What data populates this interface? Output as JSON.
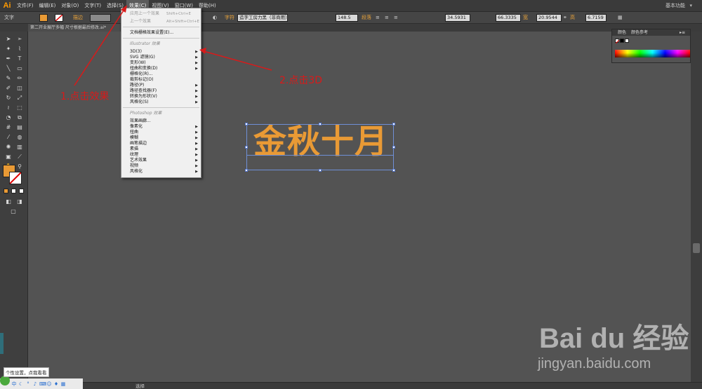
{
  "app": {
    "logo": "Ai",
    "workspace": "基本功能",
    "workspace_arrow": "▾"
  },
  "menubar": {
    "items": [
      "文件(F)",
      "编辑(E)",
      "对象(O)",
      "文字(T)",
      "选择(S)",
      "效果(C)",
      "视图(V)",
      "窗口(W)",
      "帮助(H)"
    ]
  },
  "control_bar": {
    "tool_label": "文字",
    "stroke_label": "描边",
    "char_label": "字符",
    "font_value": "造字工房力黑（非商用）",
    "font_size": "148.5",
    "para_label": "段落",
    "x_value": "34.5931",
    "y_value": "66.3335",
    "w_label": "宽",
    "w_value": "20.9544",
    "h_label": "高",
    "h_value": "6.7159"
  },
  "doc_tab": {
    "title": "第二开业展厅多幅 尺寸根据最后修改.ai*"
  },
  "dropdown": {
    "apply_last": "应用上一个效果",
    "apply_last_shortcut": "Shift+Ctrl+E",
    "last_effect": "上一个效果",
    "last_effect_shortcut": "Alt+Shift+Ctrl+E",
    "raster_settings": "文档栅格效果设置(E)...",
    "illustrator_section": "Illustrator 效果",
    "illustrator_items": [
      "3D(3)",
      "SVG 滤镜(G)",
      "变形(W)",
      "扭曲和变换(D)",
      "栅格化(R)...",
      "裁剪标记(O)",
      "路径(P)",
      "路径查找器(F)",
      "转换为形状(V)",
      "风格化(S)"
    ],
    "photoshop_section": "Photoshop 效果",
    "photoshop_items": [
      "效果画廊...",
      "像素化",
      "扭曲",
      "模糊",
      "画笔描边",
      "素描",
      "纹理",
      "艺术效果",
      "视频",
      "风格化"
    ]
  },
  "color_panel": {
    "tab_color": "颜色",
    "tab_guide": "颜色参考"
  },
  "annotations": {
    "step1": "1.点击效果",
    "step2": "2.点击3D"
  },
  "artwork": {
    "text": "金秋十月"
  },
  "status": {
    "tool": "选择"
  },
  "ime": {
    "tip": "个性设置，点我看看",
    "lang": "中"
  },
  "watermark": {
    "logo": "Bai du 经验",
    "url": "jingyan.baidu.com"
  },
  "colors": {
    "accent": "#e99a35",
    "annotation": "#d81a1a",
    "selection": "#6f8fd6"
  }
}
